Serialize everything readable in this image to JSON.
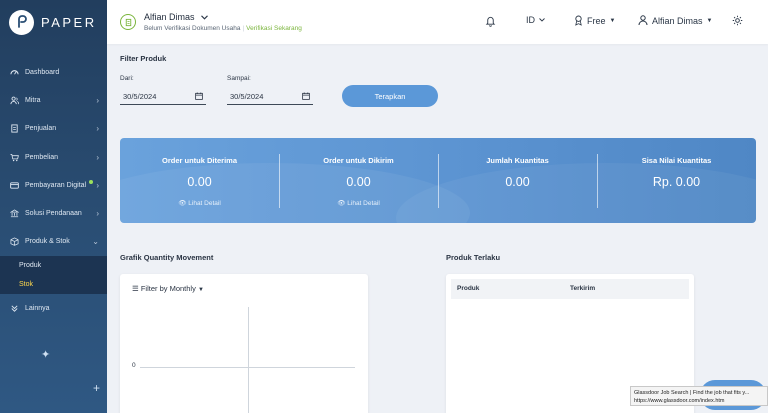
{
  "brand": {
    "name": "PAPER"
  },
  "sidebar": {
    "items": [
      {
        "label": "Dashboard",
        "icon": "speedometer-icon",
        "chevron": ""
      },
      {
        "label": "Mitra",
        "icon": "users-icon",
        "chevron": "›"
      },
      {
        "label": "Penjualan",
        "icon": "document-icon",
        "chevron": "›"
      },
      {
        "label": "Pembelian",
        "icon": "cart-icon",
        "chevron": "›"
      },
      {
        "label": "Pembayaran Digital",
        "icon": "card-icon",
        "chevron": "›"
      },
      {
        "label": "Solusi Pendanaan",
        "icon": "bank-icon",
        "chevron": "›"
      },
      {
        "label": "Produk & Stok",
        "icon": "box-icon",
        "chevron": "⌄"
      }
    ],
    "subitems": [
      {
        "label": "Produk"
      },
      {
        "label": "Stok"
      }
    ],
    "extra": {
      "label": "Lainnya",
      "icon": "chevrons-down-icon"
    }
  },
  "topbar": {
    "user_name": "Alfian Dimas",
    "verify_status": "Belum Verifikasi Dokumen Usaha",
    "verify_separator": "|",
    "verify_link": "Verifikasi Sekarang",
    "language": "ID",
    "plan": "Free",
    "account_name": "Alfian Dimas"
  },
  "filter": {
    "title": "Filter Produk",
    "from_label": "Dari:",
    "from_value": "30/5/2024",
    "to_label": "Sampai:",
    "to_value": "30/5/2024",
    "apply_label": "Terapkan"
  },
  "summary": [
    {
      "label": "Order untuk Diterima",
      "value": "0.00",
      "link": "Lihat Detail"
    },
    {
      "label": "Order untuk Dikirim",
      "value": "0.00",
      "link": "Lihat Detail"
    },
    {
      "label": "Jumlah Kuantitas",
      "value": "0.00",
      "link": ""
    },
    {
      "label": "Sisa Nilai Kuantitas",
      "value": "Rp. 0.00",
      "link": ""
    }
  ],
  "chart": {
    "title": "Grafik Quantity Movement",
    "filter_label": "Filter by Monthly",
    "y_tick": "0"
  },
  "best_products": {
    "title": "Produk Terlaku",
    "columns": [
      "Produk",
      "Terkirim"
    ]
  },
  "tooltip": {
    "line1": "Glassdoor Job Search | Find the job that fits y...",
    "line2": "https://www.glassdoor.com/index.htm"
  },
  "colors": {
    "accent": "#5b98d8",
    "verify": "#7bb53d",
    "sidebar": "#223e5e",
    "active_sub": "#ffd84d"
  }
}
